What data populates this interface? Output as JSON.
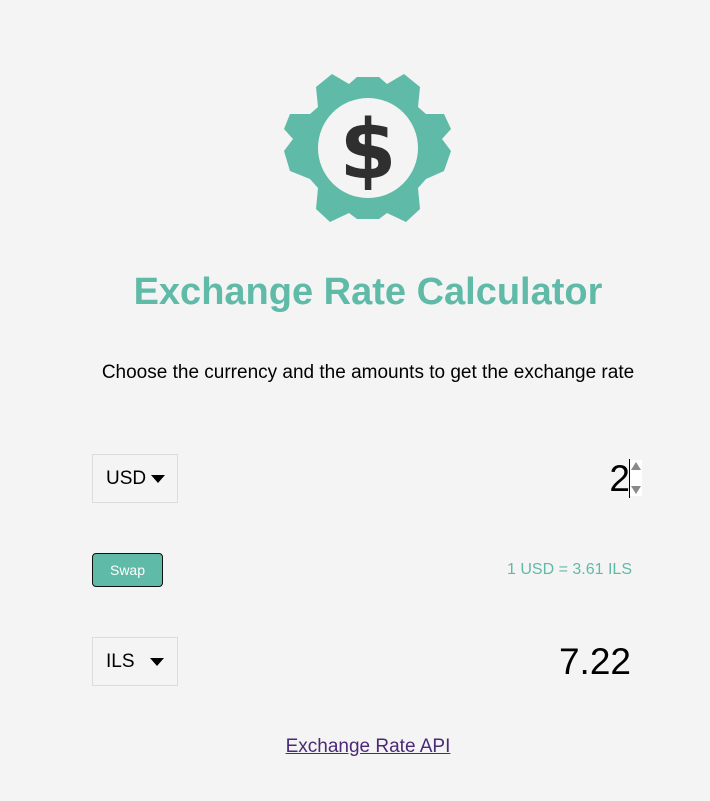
{
  "header": {
    "logo_icon": "dollar-gear-icon",
    "title": "Exchange Rate Calculator",
    "subtitle": "Choose the currency and the amounts to get the exchange rate"
  },
  "converter": {
    "from_currency": "USD",
    "from_amount": "2",
    "swap_label": "Swap",
    "rate_text": "1 USD = 3.61 ILS",
    "to_currency": "ILS",
    "to_amount": "7.22"
  },
  "footer": {
    "link_text": "Exchange Rate API"
  },
  "colors": {
    "accent": "#5fbaa7",
    "background": "#f4f4f4",
    "icon_dark": "#2f2f2f",
    "link": "#4b2a77"
  }
}
